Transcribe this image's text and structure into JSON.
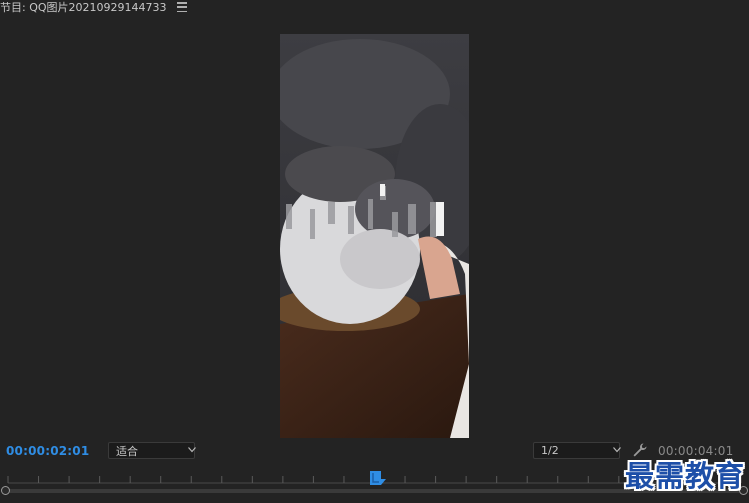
{
  "panel": {
    "title": "节目: QQ图片20210929144733",
    "menu_icon": "hamburger-menu-icon"
  },
  "controls": {
    "current_timecode": "00:00:02:01",
    "fit_dropdown": {
      "selected": "适合"
    },
    "resolution_dropdown": {
      "selected": "1/2"
    },
    "settings_icon": "wrench-icon",
    "duration_timecode": "00:00:04:01"
  },
  "timeline": {
    "playhead_icon": "playhead-marker-icon",
    "playhead_position_fraction": 0.5
  },
  "watermark": {
    "text": "最需教育"
  },
  "colors": {
    "background": "#232323",
    "timecode_blue": "#2f8de4",
    "watermark_blue": "#1d4fa8"
  }
}
